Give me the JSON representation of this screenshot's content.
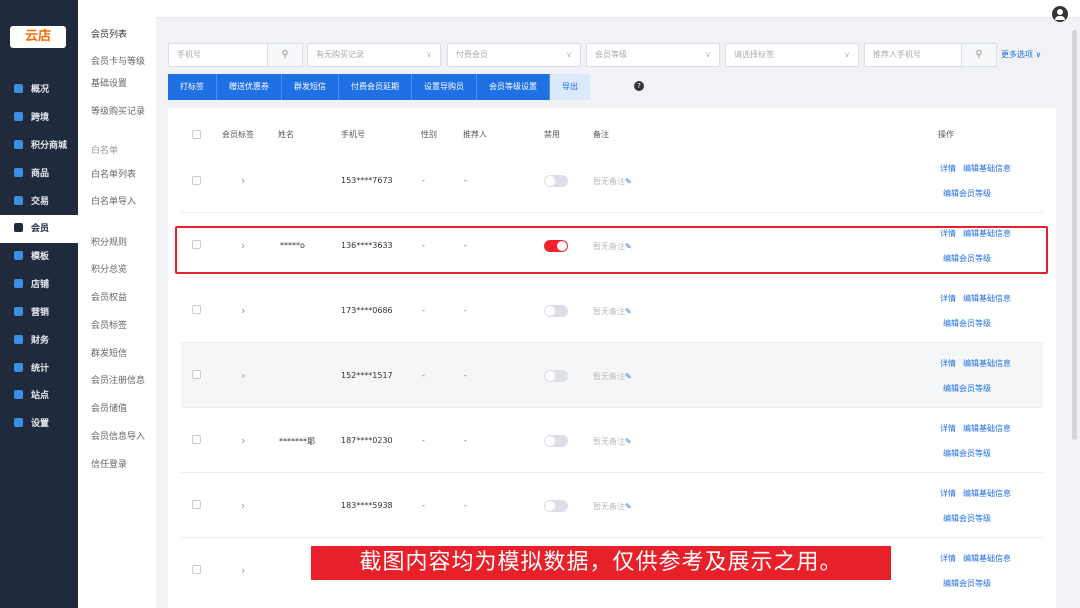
{
  "logo": {
    "text": "云店",
    "color": "#ff6a00"
  },
  "sidebar": {
    "items": [
      {
        "label": "概况",
        "icon": "dashboard-icon",
        "color": "#3a8ee6"
      },
      {
        "label": "跨境",
        "icon": "globe-icon",
        "color": "#3a8ee6"
      },
      {
        "label": "积分商城",
        "icon": "points-icon",
        "color": "#3a8ee6"
      },
      {
        "label": "商品",
        "icon": "bag-icon",
        "color": "#3a8ee6"
      },
      {
        "label": "交易",
        "icon": "receipt-icon",
        "color": "#3a8ee6"
      },
      {
        "label": "会员",
        "icon": "diamond-icon",
        "color": "#1f2a3d",
        "active": true
      },
      {
        "label": "模板",
        "icon": "template-icon",
        "color": "#3a8ee6"
      },
      {
        "label": "店铺",
        "icon": "store-icon",
        "color": "#3a8ee6"
      },
      {
        "label": "营销",
        "icon": "gift-icon",
        "color": "#3a8ee6"
      },
      {
        "label": "财务",
        "icon": "wallet-icon",
        "color": "#3a8ee6"
      },
      {
        "label": "统计",
        "icon": "chart-icon",
        "color": "#3a8ee6"
      },
      {
        "label": "站点",
        "icon": "sitemap-icon",
        "color": "#3a8ee6"
      },
      {
        "label": "设置",
        "icon": "gear-icon",
        "color": "#3a8ee6"
      }
    ]
  },
  "subnav": {
    "items": [
      "会员列表",
      "会员卡与等级",
      "基础设置",
      "等级购买记录",
      "白名单",
      "白名单列表",
      "白名单导入",
      "积分规则",
      "积分总览",
      "会员权益",
      "会员标签",
      "群发短信",
      "会员注册信息",
      "会员储值",
      "会员信息导入",
      "信任登录"
    ]
  },
  "filters": {
    "phone": "手机号",
    "purchase": "有无购买记录",
    "paid_member": "付费会员",
    "level": "会员等级",
    "tag": "请选择标签",
    "referrer_phone": "推荐人手机号",
    "more": "更多选项 ∨"
  },
  "actions": [
    "打标签",
    "赠送优惠券",
    "群发短信",
    "付费会员延期",
    "设置导购员",
    "会员等级设置",
    "导出"
  ],
  "table": {
    "headers": {
      "tag": "会员标签",
      "name": "姓名",
      "phone": "手机号",
      "gender": "性别",
      "referrer": "推荐人",
      "disabled": "禁用",
      "remark": "备注",
      "ops": "操作"
    },
    "rows": [
      {
        "name": "",
        "phone": "153****7673",
        "gender": "-",
        "referrer": "-",
        "disabled": false
      },
      {
        "name": "*****o",
        "phone": "136****3633",
        "gender": "-",
        "referrer": "-",
        "disabled": true
      },
      {
        "name": "",
        "phone": "173****0686",
        "gender": "-",
        "referrer": "-",
        "disabled": false
      },
      {
        "name": "",
        "phone": "152****1517",
        "gender": "-",
        "referrer": "-",
        "disabled": false
      },
      {
        "name": "*******耶",
        "phone": "187****0230",
        "gender": "-",
        "referrer": "-",
        "disabled": false
      },
      {
        "name": "",
        "phone": "183****5938",
        "gender": "",
        "referrer": "",
        "disabled": false
      },
      {
        "name": "",
        "phone": "",
        "gender": "",
        "referrer": "",
        "disabled": false
      }
    ],
    "remark_text": "暂无备注",
    "op_detail": "详情",
    "op_edit_basic": "编辑基础信息",
    "op_edit_level": "编辑会员等级"
  },
  "banner": "截图内容均为模拟数据，仅供参考及展示之用。",
  "colors": {
    "primary": "#1f6fe5",
    "danger": "#e8202a",
    "sidebar": "#1f2a3d"
  }
}
